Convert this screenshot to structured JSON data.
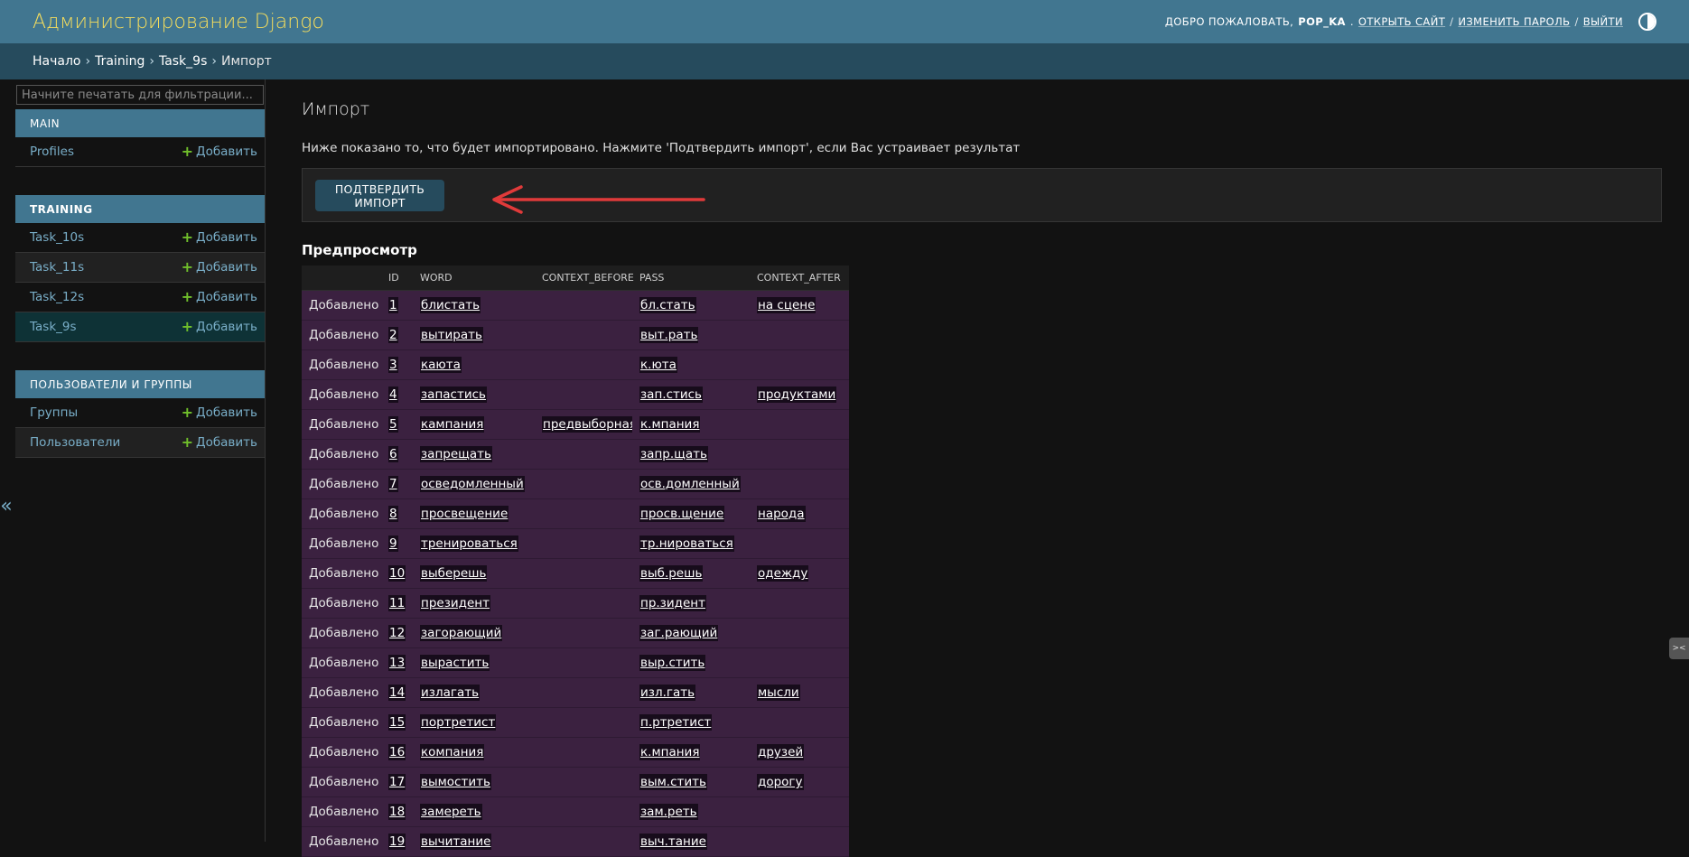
{
  "header": {
    "branding": "Администрирование Django",
    "welcome": "Добро пожаловать,",
    "username": "pop_ka",
    "view_site": "Открыть сайт",
    "change_password": "Изменить пароль",
    "logout": "Выйти",
    "separator": "/",
    "theme_icon": "half-circle-icon"
  },
  "breadcrumbs": {
    "items": [
      "Начало",
      "Training",
      "Task_9s"
    ],
    "current": "Импорт",
    "separator": "›"
  },
  "sidebar": {
    "filter_placeholder": "Начните печатать для фильтрации...",
    "add_label": "Добавить",
    "modules": [
      {
        "caption": "Main",
        "models": [
          "Profiles"
        ]
      },
      {
        "caption": "Training",
        "models": [
          "Task_10s",
          "Task_11s",
          "Task_12s",
          "Task_9s"
        ],
        "active_model": "Task_9s"
      },
      {
        "caption": "Пользователи и группы",
        "models": [
          "Группы",
          "Пользователи"
        ]
      }
    ],
    "collapse_icon": "«"
  },
  "content": {
    "title": "Импорт",
    "help_text": "Ниже показано то, что будет импортировано. Нажмите 'Подтвердить импорт', если Вас устраивает результат",
    "confirm_button": "Подтвердить импорт",
    "preview_title": "Предпросмотр"
  },
  "table": {
    "columns": [
      "",
      "ID",
      "WORD",
      "CONTEXT_BEFORE",
      "PASS",
      "CONTEXT_AFTER"
    ],
    "rows": [
      {
        "status": "Добавлено",
        "id": "1",
        "word": "блистать",
        "context_before": "",
        "pass": "бл.стать",
        "context_after": "на сцене"
      },
      {
        "status": "Добавлено",
        "id": "2",
        "word": "вытирать",
        "context_before": "",
        "pass": "выт.рать",
        "context_after": ""
      },
      {
        "status": "Добавлено",
        "id": "3",
        "word": "каюта",
        "context_before": "",
        "pass": "к.юта",
        "context_after": ""
      },
      {
        "status": "Добавлено",
        "id": "4",
        "word": "запастись",
        "context_before": "",
        "pass": "зап.стись",
        "context_after": "продуктами"
      },
      {
        "status": "Добавлено",
        "id": "5",
        "word": "кампания",
        "context_before": "предвыборная",
        "pass": "к.мпания",
        "context_after": ""
      },
      {
        "status": "Добавлено",
        "id": "6",
        "word": "запрещать",
        "context_before": "",
        "pass": "запр.щать",
        "context_after": ""
      },
      {
        "status": "Добавлено",
        "id": "7",
        "word": "осведомленный",
        "context_before": "",
        "pass": "осв.домленный",
        "context_after": ""
      },
      {
        "status": "Добавлено",
        "id": "8",
        "word": "просвещение",
        "context_before": "",
        "pass": "просв.щение",
        "context_after": "народа"
      },
      {
        "status": "Добавлено",
        "id": "9",
        "word": "тренироваться",
        "context_before": "",
        "pass": "тр.нироваться",
        "context_after": ""
      },
      {
        "status": "Добавлено",
        "id": "10",
        "word": "выберешь",
        "context_before": "",
        "pass": "выб.решь",
        "context_after": "одежду"
      },
      {
        "status": "Добавлено",
        "id": "11",
        "word": "президент",
        "context_before": "",
        "pass": "пр.зидент",
        "context_after": ""
      },
      {
        "status": "Добавлено",
        "id": "12",
        "word": "загорающий",
        "context_before": "",
        "pass": "заг.рающий",
        "context_after": ""
      },
      {
        "status": "Добавлено",
        "id": "13",
        "word": "вырастить",
        "context_before": "",
        "pass": "выр.стить",
        "context_after": ""
      },
      {
        "status": "Добавлено",
        "id": "14",
        "word": "излагать",
        "context_before": "",
        "pass": "изл.гать",
        "context_after": "мысли"
      },
      {
        "status": "Добавлено",
        "id": "15",
        "word": "портретист",
        "context_before": "",
        "pass": "п.ртретист",
        "context_after": ""
      },
      {
        "status": "Добавлено",
        "id": "16",
        "word": "компания",
        "context_before": "",
        "pass": "к.мпания",
        "context_after": "друзей"
      },
      {
        "status": "Добавлено",
        "id": "17",
        "word": "вымостить",
        "context_before": "",
        "pass": "вым.стить",
        "context_after": "дорогу"
      },
      {
        "status": "Добавлено",
        "id": "18",
        "word": "замереть",
        "context_before": "",
        "pass": "зам.реть",
        "context_after": ""
      },
      {
        "status": "Добавлено",
        "id": "19",
        "word": "вычитание",
        "context_before": "",
        "pass": "выч.тание",
        "context_after": ""
      }
    ]
  },
  "edge_widget": "><"
}
